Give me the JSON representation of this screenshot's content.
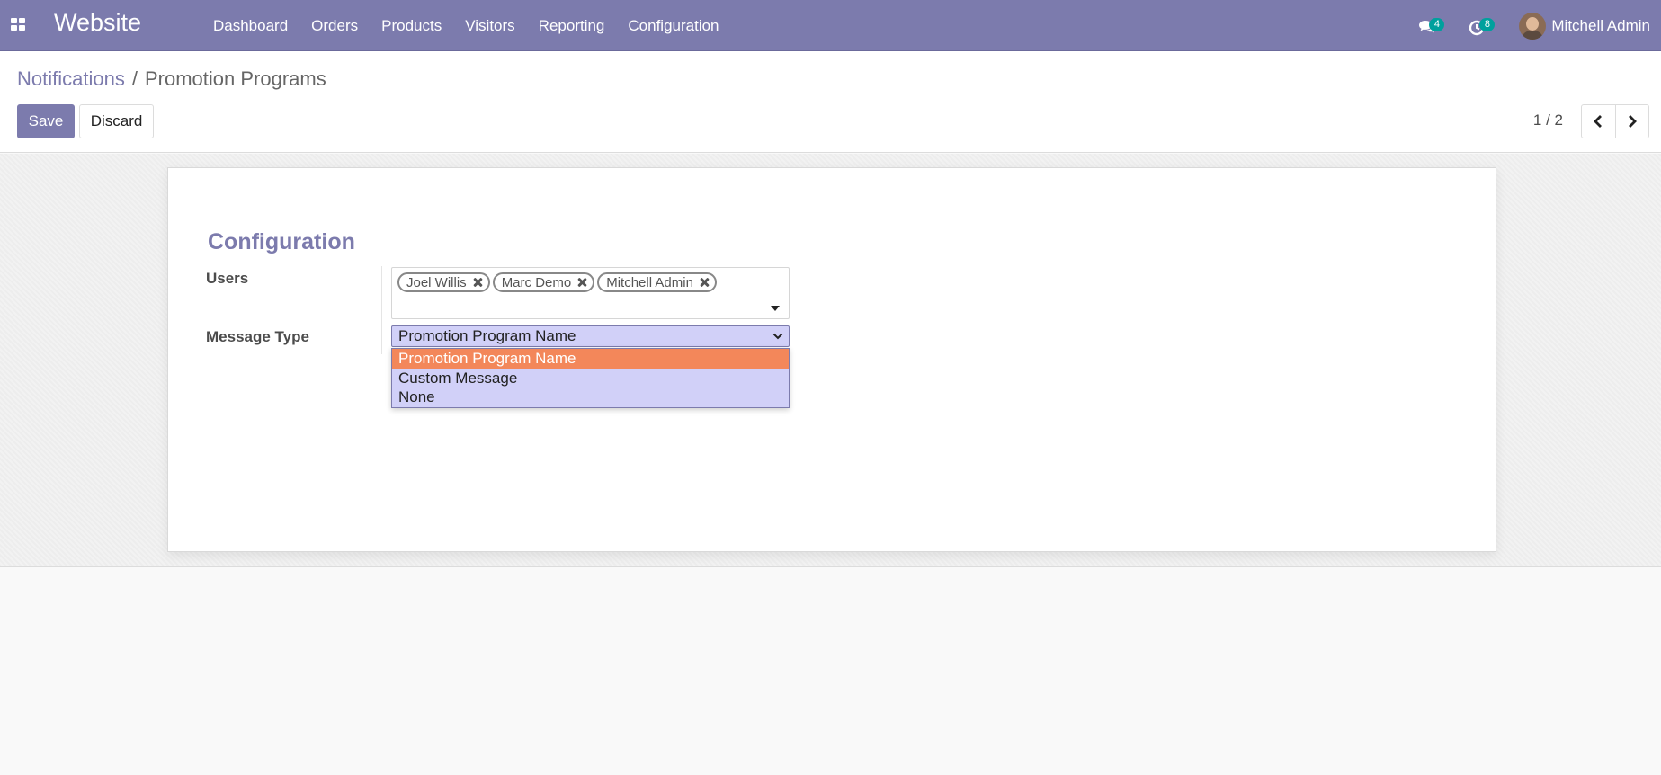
{
  "navbar": {
    "brand": "Website",
    "menu": [
      "Dashboard",
      "Orders",
      "Products",
      "Visitors",
      "Reporting",
      "Configuration"
    ],
    "messages_count": "4",
    "activities_count": "8",
    "user_name": "Mitchell Admin",
    "colors": {
      "background": "#7c7bad",
      "badge": "#00a09d"
    }
  },
  "breadcrumb": {
    "parent": "Notifications",
    "separator": "/",
    "current": "Promotion Programs"
  },
  "buttons": {
    "save": "Save",
    "discard": "Discard"
  },
  "pager": {
    "value": "1 / 2"
  },
  "form": {
    "section_title": "Configuration",
    "users_label": "Users",
    "users": [
      "Joel Willis",
      "Marc Demo",
      "Mitchell Admin"
    ],
    "message_type_label": "Message Type",
    "message_type_value": "Promotion Program Name",
    "message_type_options": [
      "Promotion Program Name",
      "Custom Message",
      "None"
    ],
    "highlighted_option": "Promotion Program Name",
    "colors": {
      "select_bg": "#d1d0f8",
      "highlight": "#f3875a"
    }
  }
}
